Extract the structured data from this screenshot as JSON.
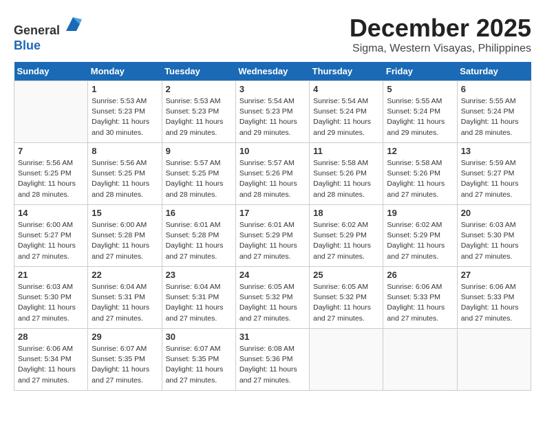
{
  "header": {
    "logo_line1": "General",
    "logo_line2": "Blue",
    "month": "December 2025",
    "location": "Sigma, Western Visayas, Philippines"
  },
  "days_of_week": [
    "Sunday",
    "Monday",
    "Tuesday",
    "Wednesday",
    "Thursday",
    "Friday",
    "Saturday"
  ],
  "weeks": [
    [
      {
        "day": "",
        "info": ""
      },
      {
        "day": "1",
        "info": "Sunrise: 5:53 AM\nSunset: 5:23 PM\nDaylight: 11 hours\nand 30 minutes."
      },
      {
        "day": "2",
        "info": "Sunrise: 5:53 AM\nSunset: 5:23 PM\nDaylight: 11 hours\nand 29 minutes."
      },
      {
        "day": "3",
        "info": "Sunrise: 5:54 AM\nSunset: 5:23 PM\nDaylight: 11 hours\nand 29 minutes."
      },
      {
        "day": "4",
        "info": "Sunrise: 5:54 AM\nSunset: 5:24 PM\nDaylight: 11 hours\nand 29 minutes."
      },
      {
        "day": "5",
        "info": "Sunrise: 5:55 AM\nSunset: 5:24 PM\nDaylight: 11 hours\nand 29 minutes."
      },
      {
        "day": "6",
        "info": "Sunrise: 5:55 AM\nSunset: 5:24 PM\nDaylight: 11 hours\nand 28 minutes."
      }
    ],
    [
      {
        "day": "7",
        "info": "Sunrise: 5:56 AM\nSunset: 5:25 PM\nDaylight: 11 hours\nand 28 minutes."
      },
      {
        "day": "8",
        "info": "Sunrise: 5:56 AM\nSunset: 5:25 PM\nDaylight: 11 hours\nand 28 minutes."
      },
      {
        "day": "9",
        "info": "Sunrise: 5:57 AM\nSunset: 5:25 PM\nDaylight: 11 hours\nand 28 minutes."
      },
      {
        "day": "10",
        "info": "Sunrise: 5:57 AM\nSunset: 5:26 PM\nDaylight: 11 hours\nand 28 minutes."
      },
      {
        "day": "11",
        "info": "Sunrise: 5:58 AM\nSunset: 5:26 PM\nDaylight: 11 hours\nand 28 minutes."
      },
      {
        "day": "12",
        "info": "Sunrise: 5:58 AM\nSunset: 5:26 PM\nDaylight: 11 hours\nand 27 minutes."
      },
      {
        "day": "13",
        "info": "Sunrise: 5:59 AM\nSunset: 5:27 PM\nDaylight: 11 hours\nand 27 minutes."
      }
    ],
    [
      {
        "day": "14",
        "info": "Sunrise: 6:00 AM\nSunset: 5:27 PM\nDaylight: 11 hours\nand 27 minutes."
      },
      {
        "day": "15",
        "info": "Sunrise: 6:00 AM\nSunset: 5:28 PM\nDaylight: 11 hours\nand 27 minutes."
      },
      {
        "day": "16",
        "info": "Sunrise: 6:01 AM\nSunset: 5:28 PM\nDaylight: 11 hours\nand 27 minutes."
      },
      {
        "day": "17",
        "info": "Sunrise: 6:01 AM\nSunset: 5:29 PM\nDaylight: 11 hours\nand 27 minutes."
      },
      {
        "day": "18",
        "info": "Sunrise: 6:02 AM\nSunset: 5:29 PM\nDaylight: 11 hours\nand 27 minutes."
      },
      {
        "day": "19",
        "info": "Sunrise: 6:02 AM\nSunset: 5:29 PM\nDaylight: 11 hours\nand 27 minutes."
      },
      {
        "day": "20",
        "info": "Sunrise: 6:03 AM\nSunset: 5:30 PM\nDaylight: 11 hours\nand 27 minutes."
      }
    ],
    [
      {
        "day": "21",
        "info": "Sunrise: 6:03 AM\nSunset: 5:30 PM\nDaylight: 11 hours\nand 27 minutes."
      },
      {
        "day": "22",
        "info": "Sunrise: 6:04 AM\nSunset: 5:31 PM\nDaylight: 11 hours\nand 27 minutes."
      },
      {
        "day": "23",
        "info": "Sunrise: 6:04 AM\nSunset: 5:31 PM\nDaylight: 11 hours\nand 27 minutes."
      },
      {
        "day": "24",
        "info": "Sunrise: 6:05 AM\nSunset: 5:32 PM\nDaylight: 11 hours\nand 27 minutes."
      },
      {
        "day": "25",
        "info": "Sunrise: 6:05 AM\nSunset: 5:32 PM\nDaylight: 11 hours\nand 27 minutes."
      },
      {
        "day": "26",
        "info": "Sunrise: 6:06 AM\nSunset: 5:33 PM\nDaylight: 11 hours\nand 27 minutes."
      },
      {
        "day": "27",
        "info": "Sunrise: 6:06 AM\nSunset: 5:33 PM\nDaylight: 11 hours\nand 27 minutes."
      }
    ],
    [
      {
        "day": "28",
        "info": "Sunrise: 6:06 AM\nSunset: 5:34 PM\nDaylight: 11 hours\nand 27 minutes."
      },
      {
        "day": "29",
        "info": "Sunrise: 6:07 AM\nSunset: 5:35 PM\nDaylight: 11 hours\nand 27 minutes."
      },
      {
        "day": "30",
        "info": "Sunrise: 6:07 AM\nSunset: 5:35 PM\nDaylight: 11 hours\nand 27 minutes."
      },
      {
        "day": "31",
        "info": "Sunrise: 6:08 AM\nSunset: 5:36 PM\nDaylight: 11 hours\nand 27 minutes."
      },
      {
        "day": "",
        "info": ""
      },
      {
        "day": "",
        "info": ""
      },
      {
        "day": "",
        "info": ""
      }
    ]
  ]
}
